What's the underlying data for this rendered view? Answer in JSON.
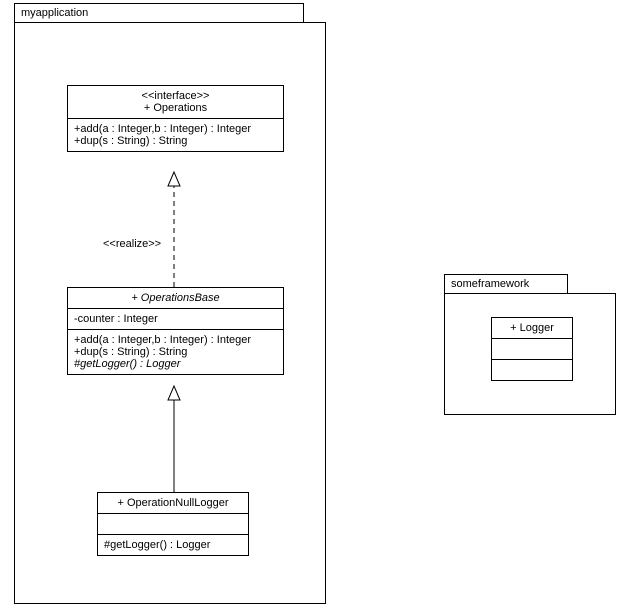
{
  "packages": {
    "app": {
      "name": "myapplication"
    },
    "framework": {
      "name": "someframework"
    }
  },
  "operations": {
    "stereotype": "<<interface>>",
    "name": "+ Operations",
    "methods": [
      "+add(a : Integer,b : Integer) : Integer",
      "+dup(s : String) : String"
    ]
  },
  "operationsBase": {
    "name": "+ OperationsBase",
    "attrs": [
      "-counter : Integer"
    ],
    "methods": [
      "+add(a : Integer,b : Integer) : Integer",
      "+dup(s : String) : String",
      "#getLogger() : Logger"
    ]
  },
  "nullLogger": {
    "name": "+ OperationNullLogger",
    "methods": [
      "#getLogger() : Logger"
    ]
  },
  "logger": {
    "name": "+ Logger"
  },
  "relations": {
    "realize": "<<realize>>"
  }
}
